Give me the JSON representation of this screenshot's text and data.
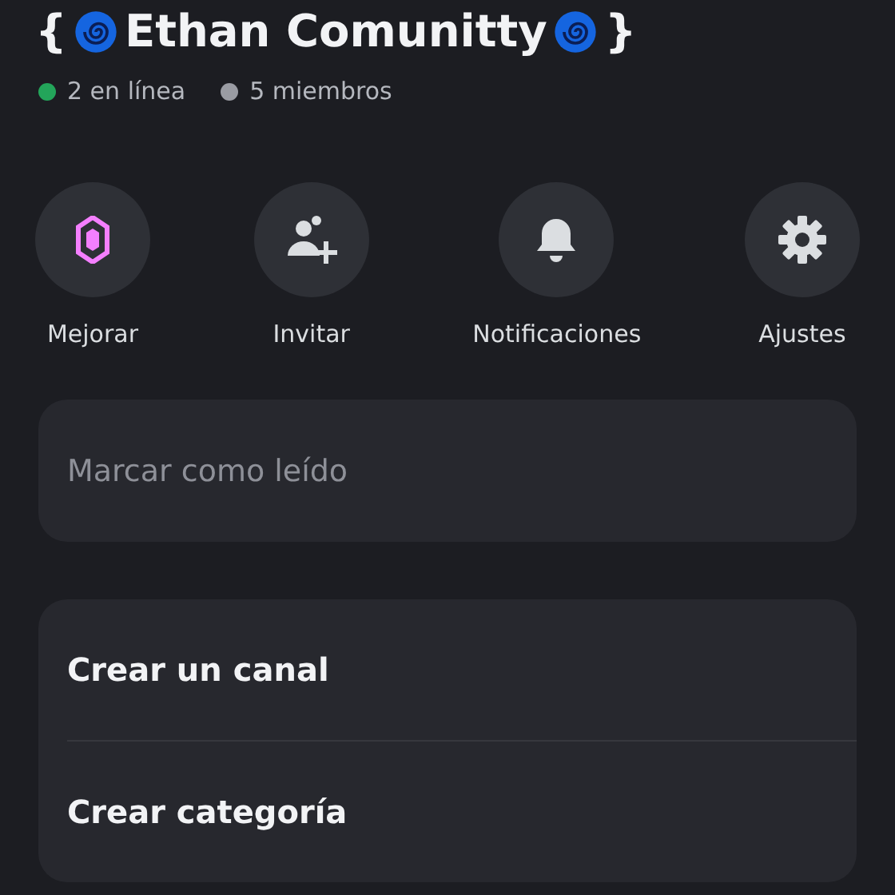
{
  "server": {
    "title_open": "{",
    "title_name": "Ethan Comunitty",
    "title_close": "}"
  },
  "status": [
    {
      "label": "2 en línea",
      "color": "#23a55a"
    },
    {
      "label": "5 miembros",
      "color": "#9a9ca3"
    }
  ],
  "actions": [
    {
      "label": "Mejorar",
      "kind": "boost"
    },
    {
      "label": "Invitar",
      "kind": "invite"
    },
    {
      "label": "Notificaciones",
      "kind": "bell"
    },
    {
      "label": "Ajustes",
      "kind": "gear"
    }
  ],
  "mark_read": {
    "label": "Marcar como leído"
  },
  "menu": [
    {
      "label": "Crear un canal"
    },
    {
      "label": "Crear categoría"
    }
  ]
}
